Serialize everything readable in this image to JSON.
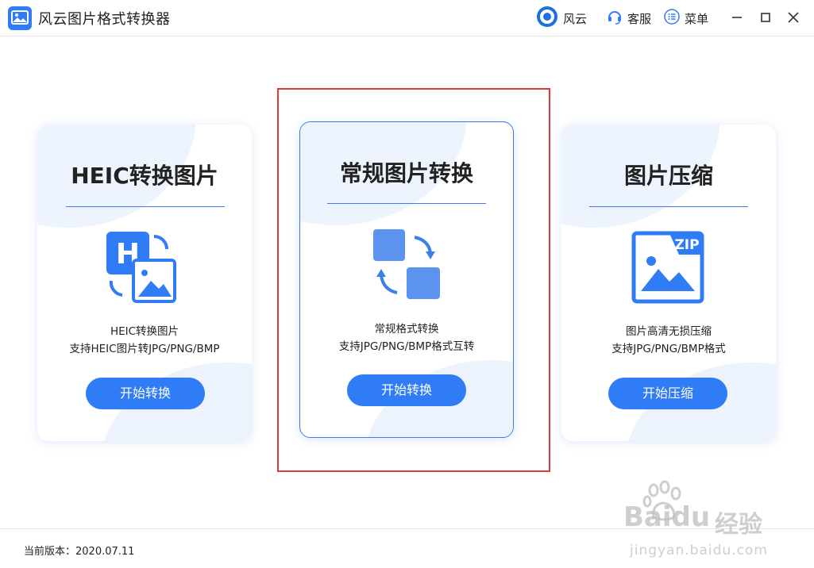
{
  "window": {
    "title": "风云图片格式转换器",
    "toolbar": {
      "fengyun_label": "风云",
      "kefu_label": "客服",
      "menu_label": "菜单"
    }
  },
  "cards": [
    {
      "heading": "HEIC转换图片",
      "desc_line1": "HEIC转换图片",
      "desc_line2": "支持HEIC图片转JPG/PNG/BMP",
      "button_label": "开始转换",
      "icon": "heic-convert-icon"
    },
    {
      "heading": "常规图片转换",
      "desc_line1": "常规格式转换",
      "desc_line2": "支持JPG/PNG/BMP格式互转",
      "button_label": "开始转换",
      "icon": "convert-arrows-icon",
      "highlighted": true
    },
    {
      "heading": "图片压缩",
      "desc_line1": "图片高清无损压缩",
      "desc_line2": "支持JPG/PNG/BMP格式",
      "button_label": "开始压缩",
      "icon": "zip-image-icon",
      "zip_label": "ZIP"
    }
  ],
  "footer": {
    "version_text": "当前版本：2020.07.11"
  },
  "watermark": {
    "brand": "Baidu",
    "brand_cn": "经验",
    "url": "jingyan.baidu.com"
  },
  "colors": {
    "accent": "#2f7cf6",
    "highlight_border": "#e23a3a",
    "card_border": "#3b7be8"
  }
}
